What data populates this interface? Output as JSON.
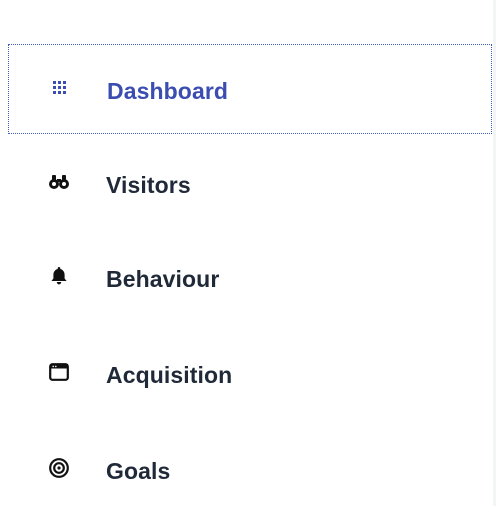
{
  "sidebar": {
    "items": [
      {
        "label": "Dashboard",
        "icon": "grid-icon",
        "active": true
      },
      {
        "label": "Visitors",
        "icon": "binoculars-icon",
        "active": false
      },
      {
        "label": "Behaviour",
        "icon": "bell-icon",
        "active": false
      },
      {
        "label": "Acquisition",
        "icon": "window-icon",
        "active": false
      },
      {
        "label": "Goals",
        "icon": "target-icon",
        "active": false
      }
    ]
  },
  "colors": {
    "active": "#3b4db0",
    "text": "#1f2937",
    "icon": "#111111"
  }
}
